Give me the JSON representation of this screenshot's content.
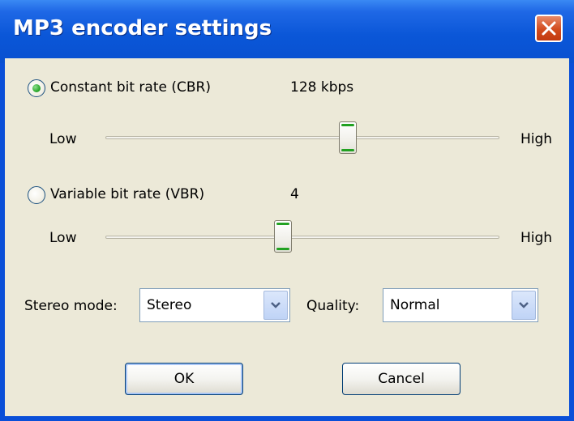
{
  "window": {
    "title": "MP3 encoder settings"
  },
  "cbr": {
    "label": "Constant bit rate (CBR)",
    "value": "128 kbps",
    "selected": true,
    "slider": {
      "low": "Low",
      "high": "High",
      "position": 0.6
    }
  },
  "vbr": {
    "label": "Variable bit rate (VBR)",
    "value": "4",
    "selected": false,
    "slider": {
      "low": "Low",
      "high": "High",
      "position": 0.45
    }
  },
  "stereo": {
    "label": "Stereo mode:",
    "value": "Stereo"
  },
  "quality": {
    "label": "Quality:",
    "value": "Normal"
  },
  "buttons": {
    "ok": "OK",
    "cancel": "Cancel"
  },
  "colors": {
    "titlebar": "#0a4fd8",
    "client": "#ece9d8",
    "close": "#d24b1d",
    "radio_dot": "#21a121"
  }
}
